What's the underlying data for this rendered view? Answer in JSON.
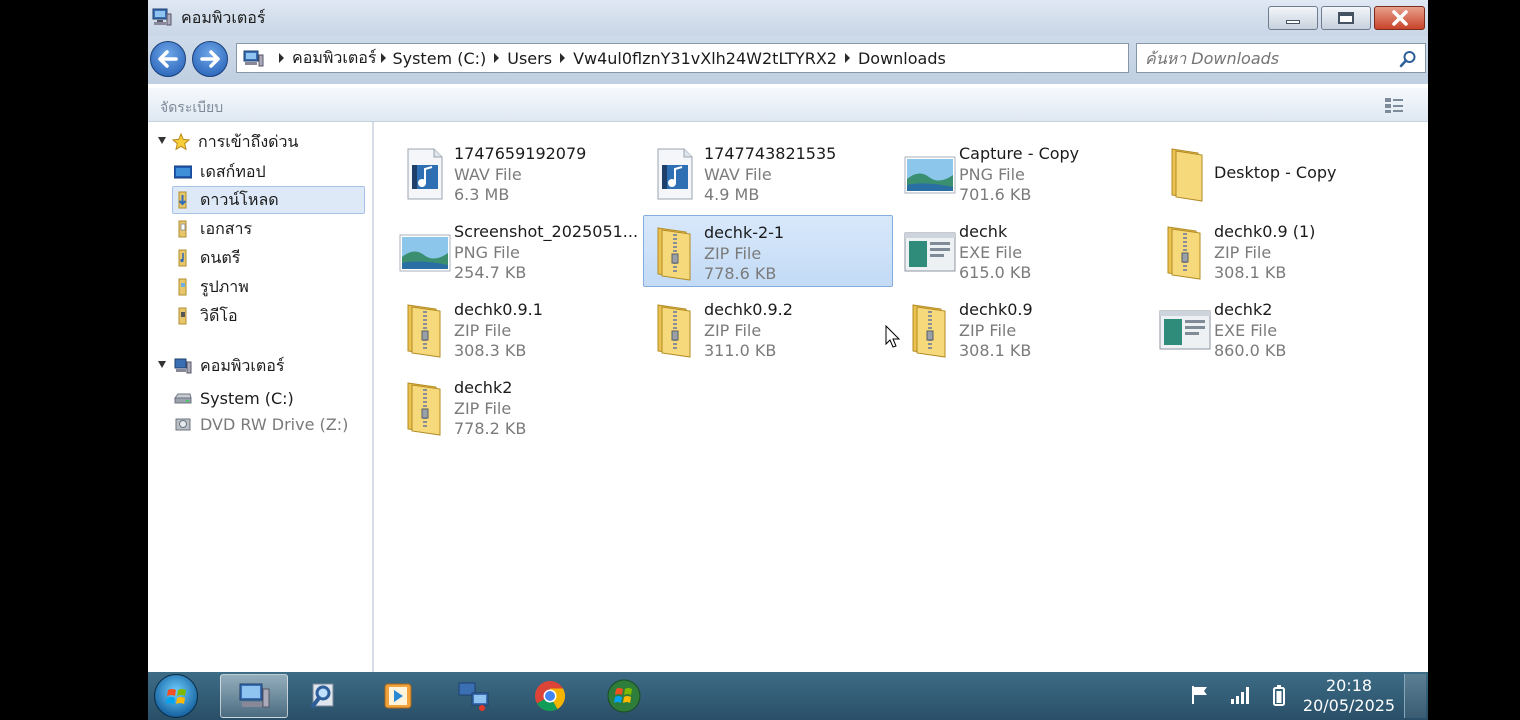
{
  "window": {
    "title": "คอมพิวเตอร์"
  },
  "address": {
    "crumbs": [
      "คอมพิวเตอร์",
      "System (C:)",
      "Users",
      "Vw4ul0flznY31vXlh24W2tLTYRX2",
      "Downloads"
    ]
  },
  "search": {
    "placeholder": "ค้นหา Downloads"
  },
  "toolbar": {
    "organize_label": "จัดระเบียบ"
  },
  "nav": {
    "favorites_label": "การเข้าถึงด่วน",
    "favorites": [
      {
        "label": "เดสก์ทอป"
      },
      {
        "label": "ดาวน์โหลด"
      },
      {
        "label": "เอกสาร"
      },
      {
        "label": "ดนตรี"
      },
      {
        "label": "รูปภาพ"
      },
      {
        "label": "วิดีโอ"
      }
    ],
    "computer_label": "คอมพิวเตอร์",
    "drives": [
      {
        "label": "System (C:)"
      },
      {
        "label": "DVD RW Drive (Z:)"
      }
    ]
  },
  "files": [
    {
      "name": "1747659192079",
      "type": "WAV File",
      "size": "6.3 MB",
      "icon": "audio-file-icon"
    },
    {
      "name": "1747743821535",
      "type": "WAV File",
      "size": "4.9 MB",
      "icon": "audio-file-icon"
    },
    {
      "name": "Capture - Copy",
      "type": "PNG File",
      "size": "701.6 KB",
      "icon": "image-file-icon"
    },
    {
      "name": "Desktop - Copy",
      "type": "",
      "size": "",
      "icon": "folder-icon"
    },
    {
      "name": "Screenshot_2025051...",
      "type": "PNG File",
      "size": "254.7 KB",
      "icon": "image-file-icon"
    },
    {
      "name": "dechk-2-1",
      "type": "ZIP File",
      "size": "778.6 KB",
      "icon": "zip-folder-icon"
    },
    {
      "name": "dechk",
      "type": "EXE File",
      "size": "615.0 KB",
      "icon": "exe-file-icon"
    },
    {
      "name": "dechk0.9 (1)",
      "type": "ZIP File",
      "size": "308.1 KB",
      "icon": "zip-folder-icon"
    },
    {
      "name": "dechk0.9.1",
      "type": "ZIP File",
      "size": "308.3 KB",
      "icon": "zip-folder-icon"
    },
    {
      "name": "dechk0.9.2",
      "type": "ZIP File",
      "size": "311.0 KB",
      "icon": "zip-folder-icon"
    },
    {
      "name": "dechk0.9",
      "type": "ZIP File",
      "size": "308.1 KB",
      "icon": "zip-folder-icon"
    },
    {
      "name": "dechk2",
      "type": "EXE File",
      "size": "860.0 KB",
      "icon": "exe-file-icon"
    },
    {
      "name": "dechk2",
      "type": "ZIP File",
      "size": "778.2 KB",
      "icon": "zip-folder-icon"
    }
  ],
  "selected_file": "dechk-2-1",
  "taskbar": {
    "time": "20:18",
    "date": "20/05/2025"
  },
  "colors": {
    "accent": "#3399ff",
    "taskbar": "#2f5a74",
    "selection": "#cce0f7"
  }
}
